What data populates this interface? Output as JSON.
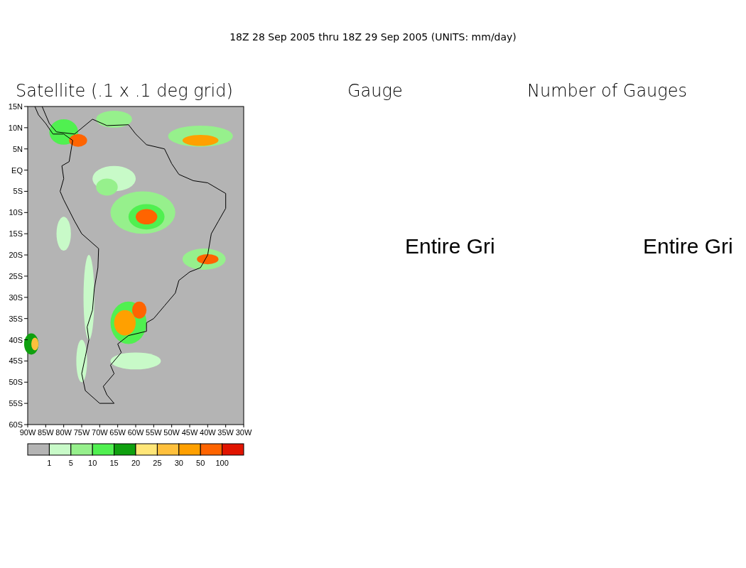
{
  "title": "18Z 28 Sep 2005 thru 18Z 29 Sep 2005 (UNITS: mm/day)",
  "panels": [
    {
      "title": "Satellite (.1 x .1 deg grid)",
      "kind": "map"
    },
    {
      "title": "Gauge",
      "kind": "message",
      "message": "Entire Gri"
    },
    {
      "title": "Number of Gauges",
      "kind": "message",
      "message": "Entire Gri"
    }
  ],
  "map": {
    "lat_labels": [
      "15N",
      "10N",
      "5N",
      "EQ",
      "5S",
      "10S",
      "15S",
      "20S",
      "25S",
      "30S",
      "35S",
      "40S",
      "45S",
      "50S",
      "55S",
      "60S"
    ],
    "lon_labels": [
      "90W",
      "85W",
      "80W",
      "75W",
      "70W",
      "65W",
      "60W",
      "55W",
      "50W",
      "45W",
      "40W",
      "35W",
      "30W"
    ]
  },
  "legend": {
    "bins": [
      {
        "color": "#b4b4b4"
      },
      {
        "color": "#c8fac8"
      },
      {
        "color": "#96f08c"
      },
      {
        "color": "#50f050"
      },
      {
        "color": "#0fa00f"
      },
      {
        "color": "#ffe678"
      },
      {
        "color": "#ffc03c"
      },
      {
        "color": "#ffa000"
      },
      {
        "color": "#ff6400"
      },
      {
        "color": "#e11400"
      }
    ],
    "labels": [
      "1",
      "5",
      "10",
      "15",
      "20",
      "25",
      "30",
      "50",
      "100"
    ]
  }
}
